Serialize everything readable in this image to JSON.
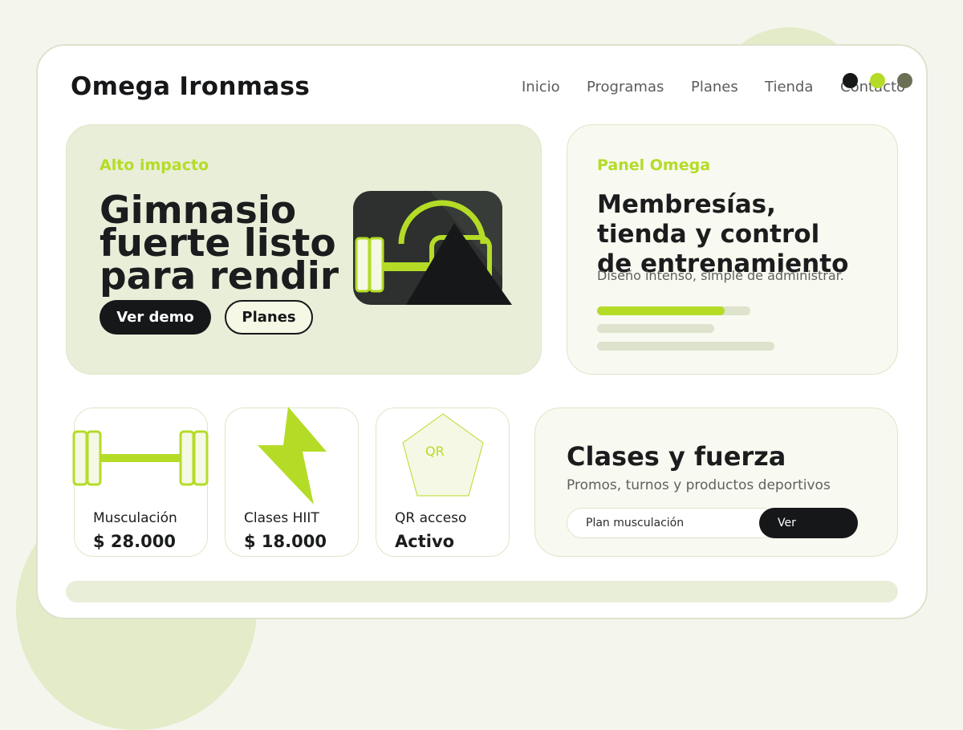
{
  "brand": {
    "name": "Omega Ironmass"
  },
  "nav": {
    "items": [
      "Inicio",
      "Programas",
      "Planes",
      "Tienda",
      "Contacto"
    ]
  },
  "colors": {
    "accent": "#b4dc27",
    "dark": "#161719",
    "muted": "#6b6f55",
    "panel": "#e9eed9"
  },
  "window_dots": [
    "#161719",
    "#b4dc27",
    "#6b6f55"
  ],
  "hero": {
    "eyebrow": "Alto impacto",
    "title": "Gimnasio fuerte listo para rendir",
    "primary_button": "Ver demo",
    "secondary_button": "Planes",
    "art_icons": [
      "dumbbell-icon",
      "kettlebell-icon",
      "mountain-icon"
    ]
  },
  "panel": {
    "eyebrow": "Panel Omega",
    "title": "Membresías, tienda y control de entrenamiento",
    "subtitle": "Diseño intenso, simple de administrar.",
    "progress": 0.83
  },
  "cards": [
    {
      "icon": "dumbbell-icon",
      "label": "Musculación",
      "value": "$ 28.000"
    },
    {
      "icon": "lightning-icon",
      "label": "Clases HIIT",
      "value": "$ 18.000"
    },
    {
      "icon": "qr-icon",
      "icon_text": "QR",
      "label": "QR acceso",
      "value": "Activo"
    }
  ],
  "classes": {
    "title": "Clases y fuerza",
    "subtitle": "Promos, turnos y productos deportivos",
    "input_value": "Plan musculación",
    "button": "Ver"
  }
}
